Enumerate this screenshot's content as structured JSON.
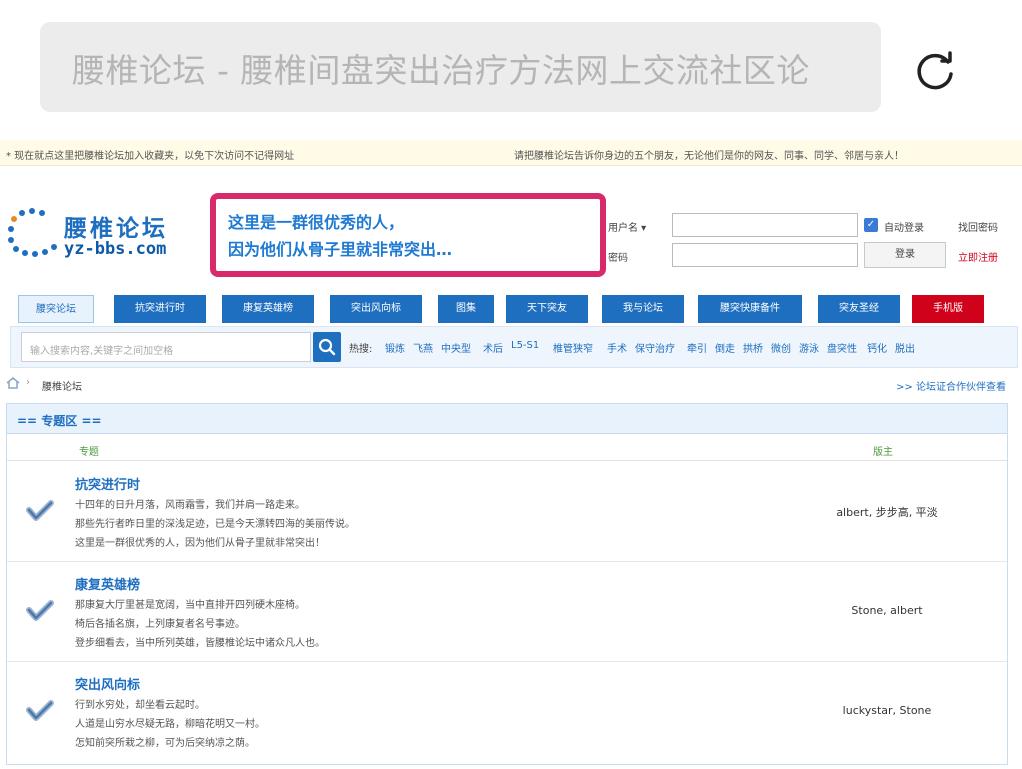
{
  "browser": {
    "url_title": "腰椎论坛 - 腰椎间盘突出治疗方法网上交流社区论"
  },
  "notice": {
    "left": "* 现在就点这里把腰椎论坛加入收藏夹，以免下次访问不记得网址",
    "right": "请把腰椎论坛告诉你身边的五个朋友，无论他们是你的网友、同事、同学、邻居与亲人！"
  },
  "logo": {
    "cn": "腰椎论坛",
    "en": "yz-bbs.com"
  },
  "slogan": {
    "line1": "这里是一群很优秀的人，",
    "line2": "因为他们从骨子里就非常突出…"
  },
  "login": {
    "username_label": "用户名 ▾",
    "password_label": "密码",
    "auto_login": "自动登录",
    "forgot": "找回密码",
    "login_button": "登录",
    "register": "立即注册"
  },
  "nav": [
    "腰突论坛",
    "抗突进行时",
    "康复英雄榜",
    "突出风向标",
    "图集",
    "天下突友",
    "我与论坛",
    "腰突快康备件",
    "突友圣经",
    "手机版"
  ],
  "search": {
    "placeholder": "输入搜索内容,关键字之间加空格",
    "hot_label": "热搜:",
    "hot": [
      "锻炼",
      "飞燕",
      "中央型",
      "术后",
      "L5-S1",
      "椎管狭窄",
      "手术",
      "保守治疗",
      "牵引",
      "倒走",
      "拱桥",
      "微创",
      "游泳",
      "盘突性",
      "钙化",
      "脱出"
    ]
  },
  "breadcrumb": {
    "current": "腰椎论坛",
    "right_link": ">> 论坛证合作伙伴查看"
  },
  "section": {
    "title": "== 专题区 ==",
    "col_topic": "专题",
    "col_moderator": "版主",
    "rows": [
      {
        "title": "抗突进行时",
        "lines": [
          "十四年的日升月落，风雨霜雪，我们并肩一路走来。",
          "那些先行者昨日里的深浅足迹，已是今天漂转四海的美丽传说。",
          "这里是一群很优秀的人，因为他们从骨子里就非常突出！"
        ],
        "moderators": "albert, 步步高, 平淡"
      },
      {
        "title": "康复英雄榜",
        "lines": [
          "那康复大厅里甚是宽阔，当中直排开四列硬木座椅。",
          "椅后各插名旗，上列康复者名号事迹。",
          "登步细看去，当中所列英雄，皆腰椎论坛中诸众凡人也。"
        ],
        "moderators": "Stone, albert"
      },
      {
        "title": "突出风向标",
        "lines": [
          "行到水穷处，却坐看云起时。",
          "人道是山穷水尽疑无路，柳暗花明又一村。",
          "怎知前突所栽之柳，可为后突纳凉之荫。"
        ],
        "moderators": "luckystar, Stone"
      }
    ]
  },
  "colors": {
    "brand_blue": "#1f6fc0",
    "accent_pink": "#d7296b",
    "alert_red": "#d0021b"
  }
}
